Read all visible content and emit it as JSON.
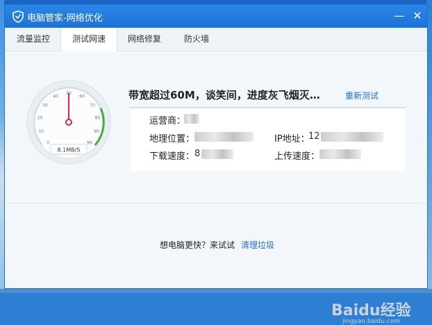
{
  "window": {
    "title": "电脑管家-网络优化",
    "minimize_icon": "minimize-icon",
    "close_icon": "close-icon",
    "min_glyph": "—",
    "close_glyph": "✕"
  },
  "tabs": [
    {
      "label": "流量监控",
      "active": false
    },
    {
      "label": "测试网速",
      "active": true
    },
    {
      "label": "网络修复",
      "active": false
    },
    {
      "label": "防火墙",
      "active": false
    }
  ],
  "speed": {
    "gauge_value_text": "8.1MB/S",
    "gauge_ticks": [
      "0",
      "10",
      "20",
      "30",
      "40",
      "50",
      "60",
      "70",
      "80",
      "90",
      "99"
    ]
  },
  "result": {
    "headline": "带宽超过60M，谈笑间，进度灰飞烟灭…",
    "retest_label": "重新测试"
  },
  "info": {
    "isp_label": "运营商：",
    "location_label": "地理位置：",
    "ip_label": "IP地址：",
    "ip_value_visible": "12",
    "download_label": "下载速度：",
    "download_value_visible": "8",
    "upload_label": "上传速度："
  },
  "footer": {
    "prompt": "想电脑更快？来试试",
    "clean_label": "清理垃圾"
  },
  "watermark": {
    "text": "Baidu经验",
    "sub": "jingyan.baidu.com"
  },
  "colors": {
    "titlebar": "#1f7bdc",
    "link": "#1f6fd0",
    "needle": "#d9263a",
    "gauge_arc": "#3fae3f"
  }
}
